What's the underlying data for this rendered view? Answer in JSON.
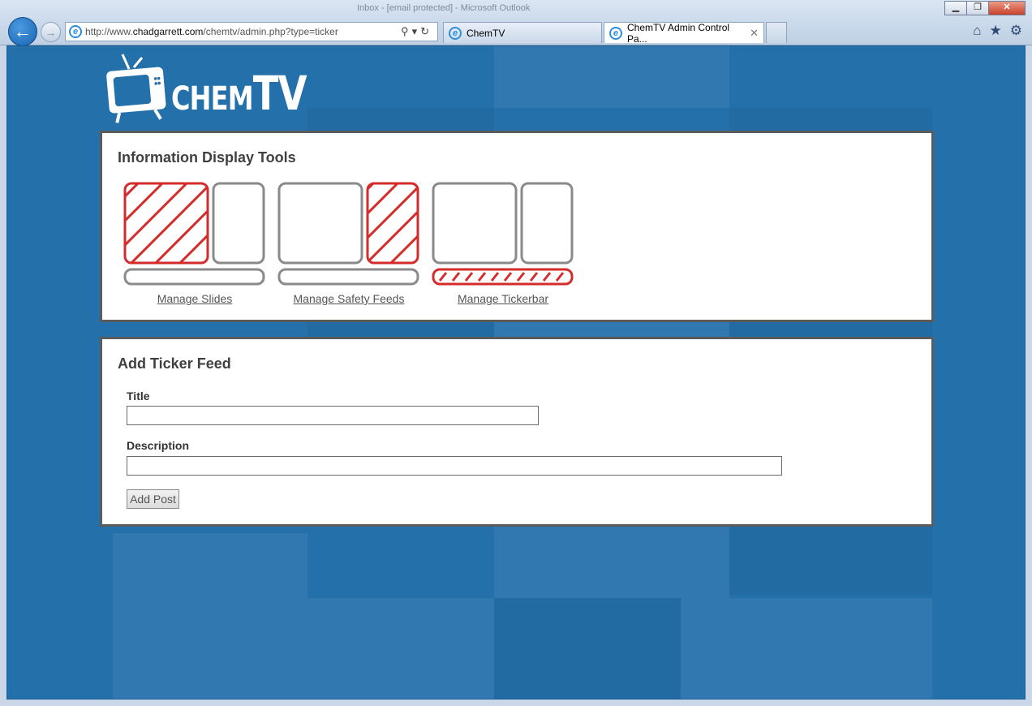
{
  "browser": {
    "caption": "Inbox - [email protected] - Microsoft Outlook",
    "window_buttons": {
      "minimize": "▁",
      "maximize": "❐",
      "close": "✕"
    },
    "back_icon": "back-arrow-icon",
    "forward_icon": "forward-arrow-icon",
    "address": {
      "prefix": "http://www.",
      "domain": "chadgarrett.com",
      "path": "/chemtv/admin.php?type=ticker",
      "tools": "⚲▾↻"
    },
    "tabs": [
      {
        "label": "ChemTV",
        "active": false
      },
      {
        "label": "ChemTV Admin Control Pa...",
        "active": true,
        "close": "✕"
      }
    ],
    "toolbar_icons": {
      "home": "⌂",
      "favorites": "★",
      "settings": "⚙"
    }
  },
  "site": {
    "logo_text_chem": "CHEM",
    "logo_text_tv": "TV",
    "colors": {
      "background": "#2470ab",
      "accent_red": "#d42b2b",
      "outline_gray": "#8a8a8a"
    }
  },
  "tools_panel": {
    "heading": "Information Display Tools",
    "tools": [
      {
        "label": "Manage Slides",
        "highlight": "main"
      },
      {
        "label": "Manage Safety Feeds",
        "highlight": "side"
      },
      {
        "label": "Manage Tickerbar",
        "highlight": "bar"
      }
    ]
  },
  "ticker_form": {
    "heading": "Add Ticker Feed",
    "title_label": "Title",
    "title_value": "",
    "description_label": "Description",
    "description_value": "",
    "submit_label": "Add Post"
  }
}
